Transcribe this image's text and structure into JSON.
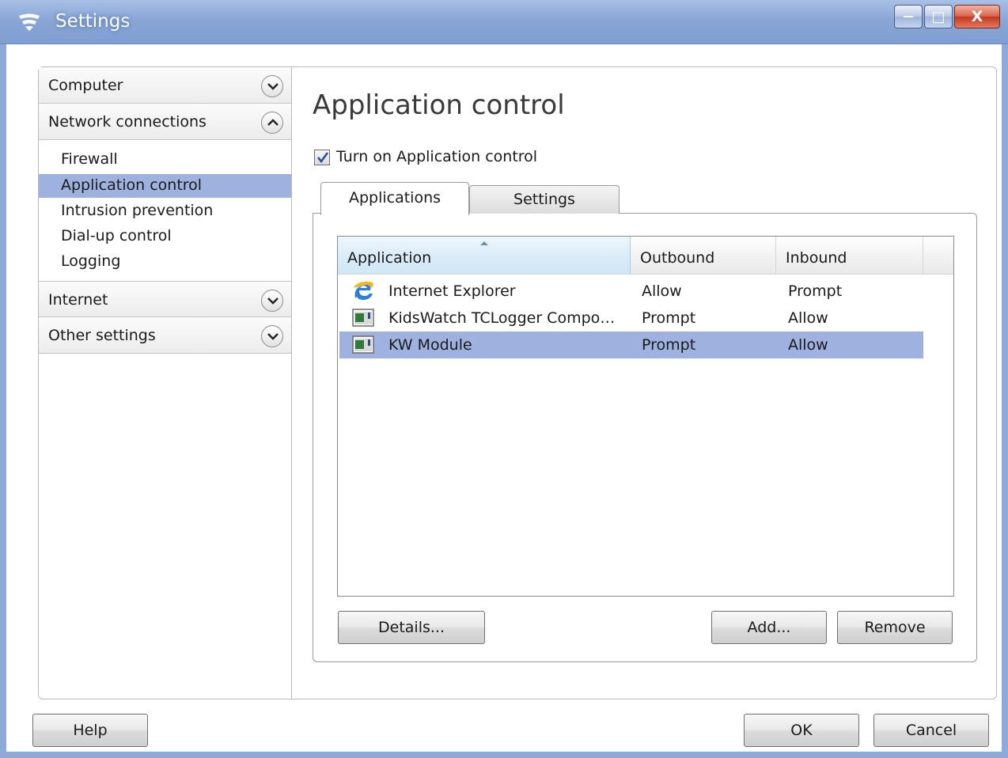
{
  "window": {
    "title": "Settings",
    "minimize_glyph": "—",
    "maximize_glyph": "□",
    "close_glyph": "X"
  },
  "sidebar": {
    "sections": [
      {
        "label": "Computer",
        "state": "collapsed"
      },
      {
        "label": "Network connections",
        "state": "expanded"
      },
      {
        "label": "Internet",
        "state": "collapsed"
      },
      {
        "label": "Other settings",
        "state": "collapsed"
      }
    ],
    "network_items": [
      {
        "label": "Firewall"
      },
      {
        "label": "Application control",
        "selected": true
      },
      {
        "label": "Intrusion prevention"
      },
      {
        "label": "Dial-up control"
      },
      {
        "label": "Logging"
      }
    ]
  },
  "content": {
    "title": "Application control",
    "enable_checkbox": {
      "label": "Turn on Application control",
      "checked": true
    },
    "tabs": [
      {
        "label": "Applications",
        "active": true
      },
      {
        "label": "Settings",
        "active": false
      }
    ],
    "table": {
      "columns": [
        "Application",
        "Outbound",
        "Inbound"
      ],
      "sorted_column": "Application",
      "rows": [
        {
          "icon": "ie-icon",
          "name": "Internet Explorer",
          "outbound": "Allow",
          "inbound": "Prompt",
          "selected": false
        },
        {
          "icon": "app-window-icon",
          "name": "KidsWatch TCLogger Compo…",
          "outbound": "Prompt",
          "inbound": "Allow",
          "selected": false
        },
        {
          "icon": "app-window-icon",
          "name": "KW Module",
          "outbound": "Prompt",
          "inbound": "Allow",
          "selected": true
        }
      ]
    },
    "buttons": {
      "details": "Details...",
      "add": "Add...",
      "remove": "Remove"
    }
  },
  "footer": {
    "help": "Help",
    "ok": "OK",
    "cancel": "Cancel"
  },
  "colors": {
    "titlebar": "#89a6d6",
    "selection": "#9fb2df",
    "border": "#b9b9b9"
  }
}
